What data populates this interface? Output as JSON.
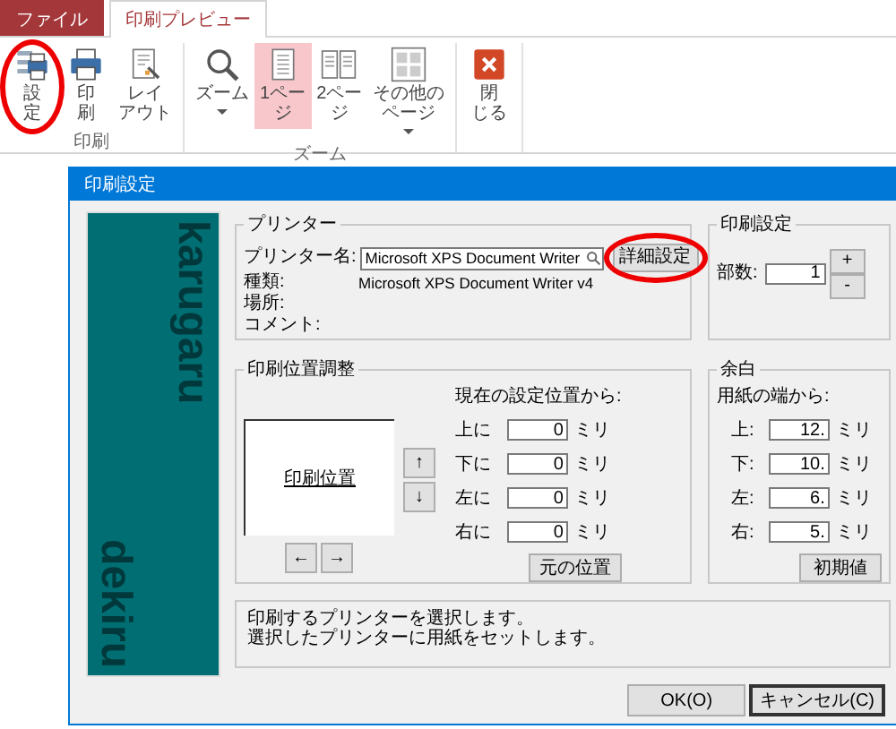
{
  "ribbon": {
    "tabs": [
      {
        "label": "ファイル",
        "kind": "file",
        "selected": false
      },
      {
        "label": "印刷プレビュー",
        "kind": "tab",
        "selected": true
      }
    ],
    "groups": [
      {
        "label": "印刷",
        "buttons": [
          {
            "lines": [
              "設",
              "定"
            ],
            "selected": false,
            "dropdown": false,
            "circled": true
          },
          {
            "lines": [
              "印",
              "刷"
            ],
            "selected": false,
            "dropdown": false,
            "circled": false
          },
          {
            "lines": [
              "レイ",
              "アウト"
            ],
            "selected": false,
            "dropdown": false,
            "circled": false
          }
        ]
      },
      {
        "label": "ズーム",
        "buttons": [
          {
            "lines": [
              "ズーム"
            ],
            "selected": false,
            "dropdown": true,
            "circled": false
          },
          {
            "lines": [
              "1ペー",
              "ジ"
            ],
            "selected": true,
            "dropdown": false,
            "circled": false
          },
          {
            "lines": [
              "2ペー",
              "ジ"
            ],
            "selected": false,
            "dropdown": false,
            "circled": false
          },
          {
            "lines": [
              "その他の",
              "ページ"
            ],
            "selected": false,
            "dropdown": true,
            "circled": false
          }
        ]
      },
      {
        "buttons": [
          {
            "lines": [
              "閉",
              "じる"
            ],
            "selected": false,
            "dropdown": false,
            "circled": false
          }
        ]
      }
    ]
  },
  "dialog": {
    "title": "印刷設定",
    "side_panel": {
      "texts": [
        "karugaru",
        "dekiru"
      ]
    },
    "printer": {
      "title": "プリンター",
      "name_label": "プリンター名:",
      "name_value": "Microsoft XPS Document Writer",
      "detail_button": {
        "label": "詳細設定",
        "circled": true
      },
      "info": [
        {
          "label": "種類:",
          "value": "Microsoft XPS Document Writer v4"
        },
        {
          "label": "場所:"
        },
        {
          "label": "コメント:"
        }
      ]
    },
    "print_settings": {
      "title": "印刷設定",
      "copies_label": "部数:",
      "copies": "1",
      "plus": "+",
      "minus": "-"
    },
    "position": {
      "title": "印刷位置調整",
      "preview_label": "印刷位置",
      "arrows": [
        "↑",
        "↓",
        "←",
        "→"
      ],
      "from_label": "現在の設定位置から:",
      "offsets": [
        {
          "label": "上に",
          "value": "0",
          "unit": "ミリ"
        },
        {
          "label": "下に",
          "value": "0",
          "unit": "ミリ"
        },
        {
          "label": "左に",
          "value": "0",
          "unit": "ミリ"
        },
        {
          "label": "右に",
          "value": "0",
          "unit": "ミリ"
        }
      ],
      "reset_button": "元の位置"
    },
    "margins": {
      "title": "余白",
      "from_label": "用紙の端から:",
      "fields": [
        {
          "label": "上:",
          "value": "12.",
          "unit": "ミリ"
        },
        {
          "label": "下:",
          "value": "10.",
          "unit": "ミリ"
        },
        {
          "label": "左:",
          "value": "6.",
          "unit": "ミリ"
        },
        {
          "label": "右:",
          "value": "5.",
          "unit": "ミリ"
        }
      ],
      "default_button": "初期値"
    },
    "message": [
      "印刷するプリンターを選択します。",
      "選択したプリンターに用紙をセットします。"
    ],
    "buttons": [
      {
        "label": "OK(O)",
        "focused": false
      },
      {
        "label": "キャンセル(C)",
        "focused": true
      }
    ]
  }
}
